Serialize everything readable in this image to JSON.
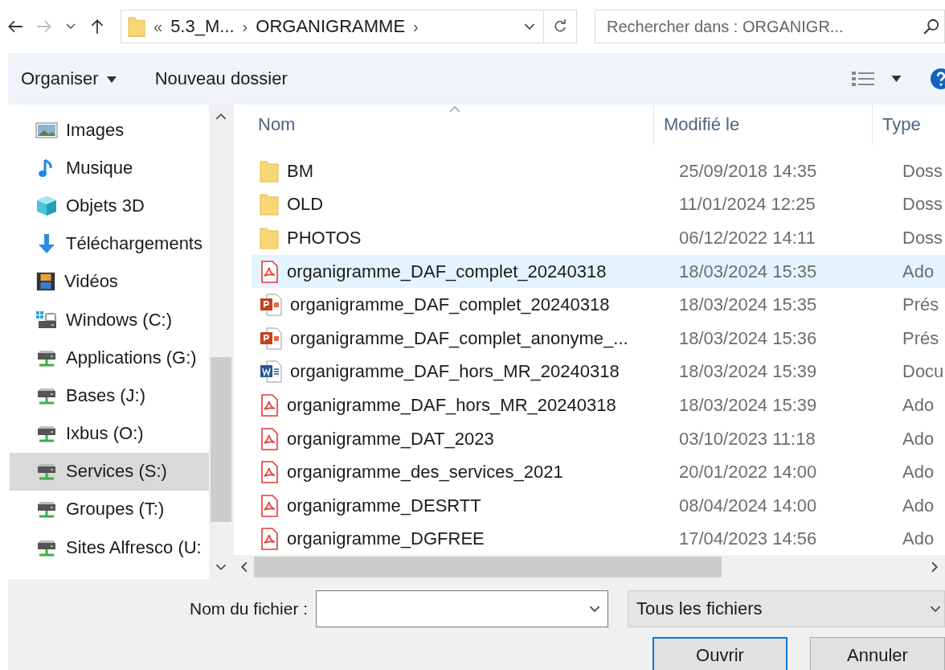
{
  "address": {
    "crumbs": [
      "«",
      "5.3_M...",
      "›",
      "ORGANIGRAMME",
      "›"
    ]
  },
  "search": {
    "placeholder": "Rechercher dans : ORGANIGR..."
  },
  "toolbar": {
    "organize": "Organiser",
    "new_folder": "Nouveau dossier"
  },
  "sidebar": {
    "items": [
      {
        "label": "Images",
        "kind": "images",
        "selected": false
      },
      {
        "label": "Musique",
        "kind": "music",
        "selected": false
      },
      {
        "label": "Objets 3D",
        "kind": "cube",
        "selected": false
      },
      {
        "label": "Téléchargements",
        "kind": "download",
        "selected": false
      },
      {
        "label": "Vidéos",
        "kind": "video",
        "selected": false
      },
      {
        "label": "Windows (C:)",
        "kind": "system",
        "selected": false
      },
      {
        "label": "Applications (G:)",
        "kind": "network",
        "selected": false
      },
      {
        "label": "Bases (J:)",
        "kind": "network",
        "selected": false
      },
      {
        "label": "Ixbus (O:)",
        "kind": "network",
        "selected": false
      },
      {
        "label": "Services (S:)",
        "kind": "network",
        "selected": true
      },
      {
        "label": "Groupes (T:)",
        "kind": "network",
        "selected": false
      },
      {
        "label": "Sites Alfresco (U:",
        "kind": "network",
        "selected": false
      }
    ]
  },
  "table": {
    "columns": [
      "Nom",
      "Modifié le",
      "Type"
    ],
    "rows": [
      {
        "name": "BM",
        "modified": "25/09/2018 14:35",
        "type": "Doss",
        "kind": "folder",
        "selected": false
      },
      {
        "name": "OLD",
        "modified": "11/01/2024 12:25",
        "type": "Doss",
        "kind": "folder",
        "selected": false
      },
      {
        "name": "PHOTOS",
        "modified": "06/12/2022 14:11",
        "type": "Doss",
        "kind": "folder",
        "selected": false
      },
      {
        "name": "organigramme_DAF_complet_20240318",
        "modified": "18/03/2024 15:35",
        "type": "Ado",
        "kind": "pdf",
        "selected": true
      },
      {
        "name": "organigramme_DAF_complet_20240318",
        "modified": "18/03/2024 15:35",
        "type": "Prés",
        "kind": "ppt",
        "selected": false
      },
      {
        "name": "organigramme_DAF_complet_anonyme_...",
        "modified": "18/03/2024 15:36",
        "type": "Prés",
        "kind": "ppt",
        "selected": false
      },
      {
        "name": "organigramme_DAF_hors_MR_20240318",
        "modified": "18/03/2024 15:39",
        "type": "Docu",
        "kind": "word",
        "selected": false
      },
      {
        "name": "organigramme_DAF_hors_MR_20240318",
        "modified": "18/03/2024 15:39",
        "type": "Ado",
        "kind": "pdf",
        "selected": false
      },
      {
        "name": "organigramme_DAT_2023",
        "modified": "03/10/2023 11:18",
        "type": "Ado",
        "kind": "pdf",
        "selected": false
      },
      {
        "name": "organigramme_des_services_2021",
        "modified": "20/01/2022 14:00",
        "type": "Ado",
        "kind": "pdf",
        "selected": false
      },
      {
        "name": "organigramme_DESRTT",
        "modified": "08/04/2024 14:00",
        "type": "Ado",
        "kind": "pdf",
        "selected": false
      },
      {
        "name": "organigramme_DGFREE",
        "modified": "17/04/2023 14:56",
        "type": "Ado",
        "kind": "pdf",
        "selected": false
      }
    ]
  },
  "footer": {
    "filename_label": "Nom du fichier :",
    "filter": "Tous les fichiers",
    "buttons": [
      "Ouvrir",
      "Annuler"
    ]
  }
}
